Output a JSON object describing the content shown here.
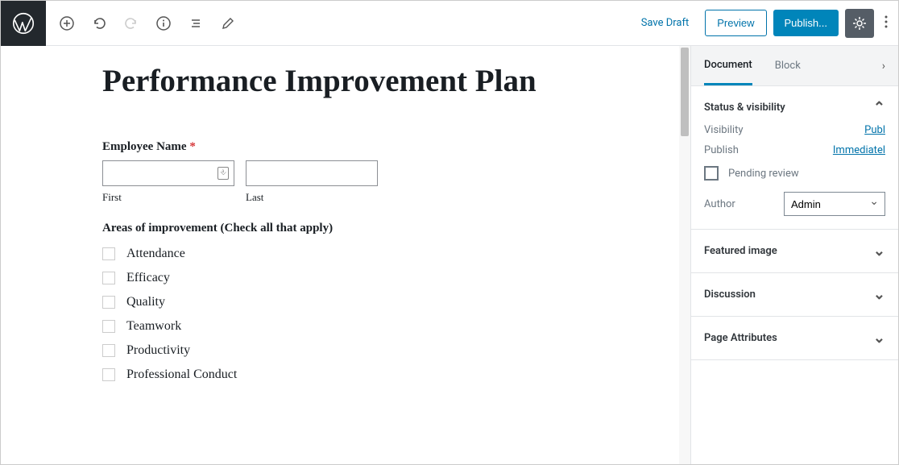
{
  "topbar": {
    "save_draft": "Save Draft",
    "preview": "Preview",
    "publish": "Publish..."
  },
  "editor": {
    "title": "Performance Improvement Plan",
    "employee_name_label": "Employee Name",
    "required_mark": "*",
    "first_label": "First",
    "last_label": "Last",
    "areas_label": "Areas of improvement (Check all that apply)",
    "areas": [
      "Attendance",
      "Efficacy",
      "Quality",
      "Teamwork",
      "Productivity",
      "Professional Conduct"
    ]
  },
  "sidebar": {
    "tabs": {
      "document": "Document",
      "block": "Block"
    },
    "status": {
      "title": "Status & visibility",
      "visibility_label": "Visibility",
      "visibility_value": "Publ",
      "publish_label": "Publish",
      "publish_value": "Immediatel",
      "pending_label": "Pending review",
      "author_label": "Author",
      "author_value": "Admin"
    },
    "featured": "Featured image",
    "discussion": "Discussion",
    "page_attributes": "Page Attributes"
  }
}
